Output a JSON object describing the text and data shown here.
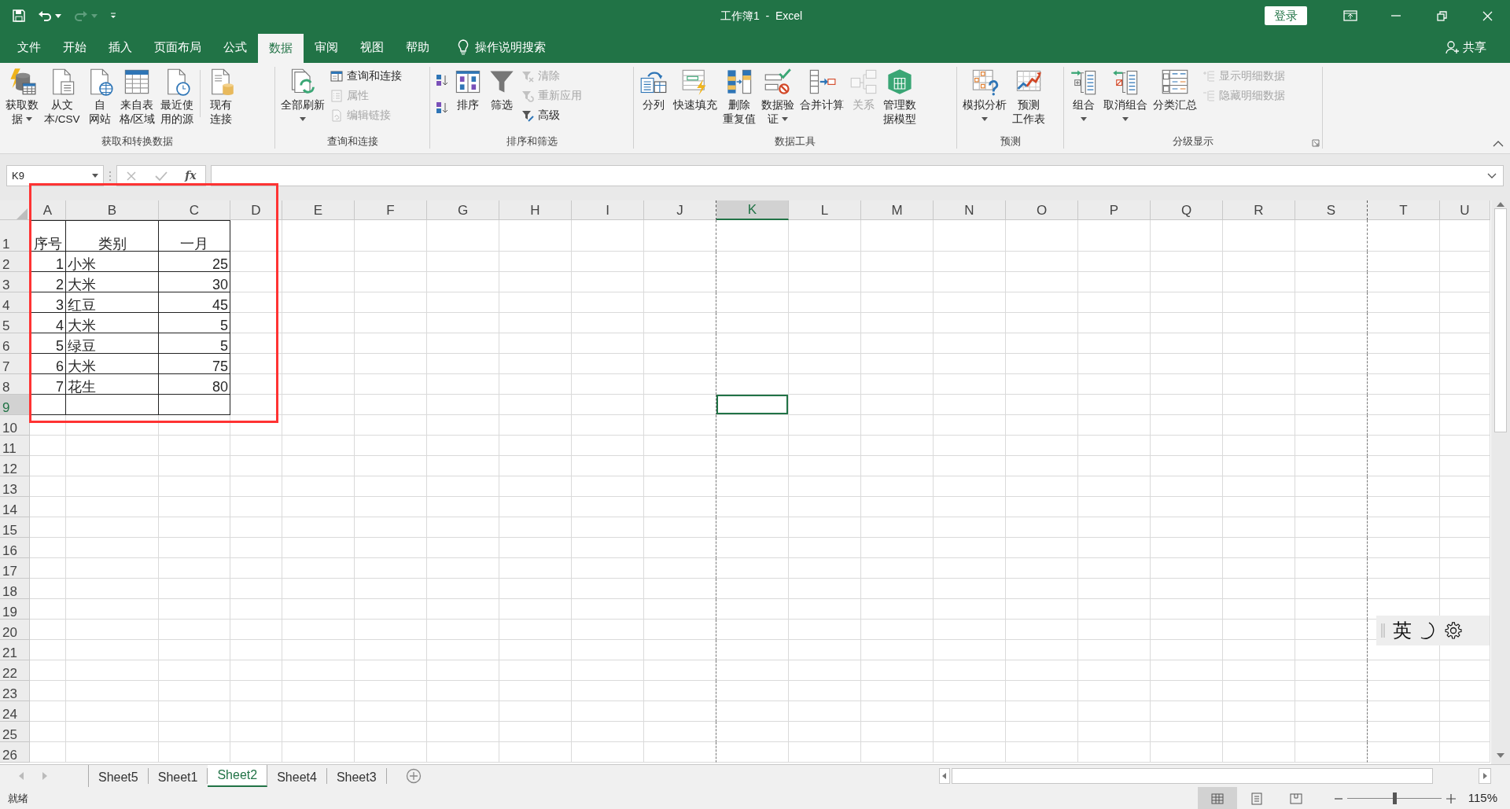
{
  "title_bar": {
    "title": "工作簿1  -  Excel",
    "sign_in": "登录",
    "redo": {
      "disabled": true
    }
  },
  "menu_tabs": [
    {
      "label": "文件",
      "selected": false
    },
    {
      "label": "开始",
      "selected": false
    },
    {
      "label": "插入",
      "selected": false
    },
    {
      "label": "页面布局",
      "selected": false
    },
    {
      "label": "公式",
      "selected": false
    },
    {
      "label": "数据",
      "selected": true
    },
    {
      "label": "审阅",
      "selected": false
    },
    {
      "label": "视图",
      "selected": false
    },
    {
      "label": "帮助",
      "selected": false
    }
  ],
  "tell_me": "操作说明搜索",
  "share": "共享",
  "ribbon": {
    "groups": [
      {
        "title": "获取和转换数据",
        "launcher": false,
        "items": [
          {
            "kind": "large",
            "lines": [
              "获取数",
              "据"
            ],
            "dropdown": true,
            "disabled": false
          },
          {
            "kind": "large",
            "lines": [
              "从文",
              "本/CSV"
            ],
            "dropdown": false,
            "disabled": false
          },
          {
            "kind": "large",
            "lines": [
              "自",
              "网站"
            ],
            "dropdown": false,
            "disabled": false
          },
          {
            "kind": "large",
            "lines": [
              "来自表",
              "格/区域"
            ],
            "dropdown": false,
            "disabled": false
          },
          {
            "kind": "large",
            "lines": [
              "最近使",
              "用的源"
            ],
            "dropdown": false,
            "disabled": false
          },
          {
            "kind": "separator"
          },
          {
            "kind": "large",
            "lines": [
              "现有",
              "连接"
            ],
            "dropdown": false,
            "disabled": false
          }
        ]
      },
      {
        "title": "查询和连接",
        "launcher": false,
        "items": [
          {
            "kind": "large",
            "lines": [
              "全部刷新"
            ],
            "dropdown": true,
            "disabled": false
          },
          {
            "kind": "stack",
            "items": [
              {
                "label": "查询和连接",
                "disabled": false
              },
              {
                "label": "属性",
                "disabled": true
              },
              {
                "label": "编辑链接",
                "disabled": true
              }
            ]
          }
        ]
      },
      {
        "title": "排序和筛选",
        "launcher": false,
        "items": [
          {
            "kind": "stack",
            "items": [
              {
                "disabled": false
              },
              {
                "disabled": false
              }
            ]
          },
          {
            "kind": "large",
            "lines": [
              "排序"
            ],
            "dropdown": false,
            "disabled": false
          },
          {
            "kind": "large",
            "lines": [
              "筛选"
            ],
            "dropdown": false,
            "disabled": false
          },
          {
            "kind": "stack",
            "items": [
              {
                "label": "清除",
                "disabled": true
              },
              {
                "label": "重新应用",
                "disabled": true
              },
              {
                "label": "高级",
                "disabled": false
              }
            ]
          }
        ]
      },
      {
        "title": "数据工具",
        "launcher": false,
        "items": [
          {
            "kind": "large",
            "lines": [
              "分列"
            ],
            "dropdown": false,
            "disabled": false
          },
          {
            "kind": "large",
            "lines": [
              "快速填充"
            ],
            "dropdown": false,
            "disabled": false
          },
          {
            "kind": "large",
            "lines": [
              "删除",
              "重复值"
            ],
            "dropdown": false,
            "disabled": false
          },
          {
            "kind": "large",
            "lines": [
              "数据验",
              "证"
            ],
            "dropdown": true,
            "disabled": false
          },
          {
            "kind": "large",
            "lines": [
              "合并计算"
            ],
            "dropdown": false,
            "disabled": false
          },
          {
            "kind": "large",
            "lines": [
              "关系"
            ],
            "dropdown": false,
            "disabled": true
          },
          {
            "kind": "large",
            "lines": [
              "管理数",
              "据模型"
            ],
            "dropdown": false,
            "disabled": false
          }
        ]
      },
      {
        "title": "预测",
        "launcher": false,
        "items": [
          {
            "kind": "large",
            "lines": [
              "模拟分析"
            ],
            "dropdown": true,
            "disabled": false
          },
          {
            "kind": "large",
            "lines": [
              "预测",
              "工作表"
            ],
            "dropdown": false,
            "disabled": false
          }
        ]
      },
      {
        "title": "分级显示",
        "launcher": true,
        "items": [
          {
            "kind": "large",
            "lines": [
              "组合"
            ],
            "dropdown": true,
            "disabled": false
          },
          {
            "kind": "large",
            "lines": [
              "取消组合"
            ],
            "dropdown": true,
            "disabled": false
          },
          {
            "kind": "large",
            "lines": [
              "分类汇总"
            ],
            "dropdown": false,
            "disabled": false
          },
          {
            "kind": "stack",
            "items": [
              {
                "label": "显示明细数据",
                "disabled": true
              },
              {
                "label": "隐藏明细数据",
                "disabled": true
              }
            ]
          }
        ]
      }
    ]
  },
  "formula_bar": {
    "name_box": "K9",
    "function_label": "fx"
  },
  "grid": {
    "columns": [
      {
        "label": "A",
        "selected": false,
        "page_break": false
      },
      {
        "label": "B",
        "selected": false,
        "page_break": false
      },
      {
        "label": "C",
        "selected": false,
        "page_break": false
      },
      {
        "label": "D",
        "selected": false,
        "page_break": false
      },
      {
        "label": "E",
        "selected": false,
        "page_break": false
      },
      {
        "label": "F",
        "selected": false,
        "page_break": false
      },
      {
        "label": "G",
        "selected": false,
        "page_break": false
      },
      {
        "label": "H",
        "selected": false,
        "page_break": false
      },
      {
        "label": "I",
        "selected": false,
        "page_break": false
      },
      {
        "label": "J",
        "selected": false,
        "page_break": true
      },
      {
        "label": "K",
        "selected": true,
        "page_break": false
      },
      {
        "label": "L",
        "selected": false,
        "page_break": false
      },
      {
        "label": "M",
        "selected": false,
        "page_break": false
      },
      {
        "label": "N",
        "selected": false,
        "page_break": false
      },
      {
        "label": "O",
        "selected": false,
        "page_break": false
      },
      {
        "label": "P",
        "selected": false,
        "page_break": false
      },
      {
        "label": "Q",
        "selected": false,
        "page_break": false
      },
      {
        "label": "R",
        "selected": false,
        "page_break": false
      },
      {
        "label": "S",
        "selected": false,
        "page_break": true
      },
      {
        "label": "T",
        "selected": false,
        "page_break": false
      },
      {
        "label": "U",
        "selected": false,
        "page_break": false
      }
    ],
    "rows": [
      {
        "label": "1",
        "selected": false,
        "tall": true,
        "cells": [
          {
            "text": "序号",
            "kind": "header",
            "bordered": true
          },
          {
            "text": "类别",
            "kind": "header",
            "bordered": true
          },
          {
            "text": "一月",
            "kind": "header",
            "bordered": true
          }
        ]
      },
      {
        "label": "2",
        "selected": false,
        "tall": false,
        "cells": [
          {
            "text": "1",
            "kind": "number",
            "bordered": true
          },
          {
            "text": "小米",
            "kind": "text",
            "bordered": true
          },
          {
            "text": "25",
            "kind": "number",
            "bordered": true
          }
        ]
      },
      {
        "label": "3",
        "selected": false,
        "tall": false,
        "cells": [
          {
            "text": "2",
            "kind": "number",
            "bordered": true
          },
          {
            "text": "大米",
            "kind": "text",
            "bordered": true
          },
          {
            "text": "30",
            "kind": "number",
            "bordered": true
          }
        ]
      },
      {
        "label": "4",
        "selected": false,
        "tall": false,
        "cells": [
          {
            "text": "3",
            "kind": "number",
            "bordered": true
          },
          {
            "text": "红豆",
            "kind": "text",
            "bordered": true
          },
          {
            "text": "45",
            "kind": "number",
            "bordered": true
          }
        ]
      },
      {
        "label": "5",
        "selected": false,
        "tall": false,
        "cells": [
          {
            "text": "4",
            "kind": "number",
            "bordered": true
          },
          {
            "text": "大米",
            "kind": "text",
            "bordered": true
          },
          {
            "text": "5",
            "kind": "number",
            "bordered": true
          }
        ]
      },
      {
        "label": "6",
        "selected": false,
        "tall": false,
        "cells": [
          {
            "text": "5",
            "kind": "number",
            "bordered": true
          },
          {
            "text": "绿豆",
            "kind": "text",
            "bordered": true
          },
          {
            "text": "5",
            "kind": "number",
            "bordered": true
          }
        ]
      },
      {
        "label": "7",
        "selected": false,
        "tall": false,
        "cells": [
          {
            "text": "6",
            "kind": "number",
            "bordered": true
          },
          {
            "text": "大米",
            "kind": "text",
            "bordered": true
          },
          {
            "text": "75",
            "kind": "number",
            "bordered": true
          }
        ]
      },
      {
        "label": "8",
        "selected": false,
        "tall": false,
        "cells": [
          {
            "text": "7",
            "kind": "number",
            "bordered": true
          },
          {
            "text": "花生",
            "kind": "text",
            "bordered": true
          },
          {
            "text": "80",
            "kind": "number",
            "bordered": true
          }
        ]
      },
      {
        "label": "9",
        "selected": true,
        "tall": false,
        "cells": [
          {
            "bordered": true
          },
          {
            "bordered": true
          },
          {
            "bordered": true
          }
        ]
      },
      {
        "label": "10",
        "selected": false,
        "tall": false
      },
      {
        "label": "11",
        "selected": false,
        "tall": false
      },
      {
        "label": "12",
        "selected": false,
        "tall": false
      },
      {
        "label": "13",
        "selected": false,
        "tall": false
      },
      {
        "label": "14",
        "selected": false,
        "tall": false
      },
      {
        "label": "15",
        "selected": false,
        "tall": false
      },
      {
        "label": "16",
        "selected": false,
        "tall": false
      },
      {
        "label": "17",
        "selected": false,
        "tall": false
      },
      {
        "label": "18",
        "selected": false,
        "tall": false
      },
      {
        "label": "19",
        "selected": false,
        "tall": false
      },
      {
        "label": "20",
        "selected": false,
        "tall": false
      },
      {
        "label": "21",
        "selected": false,
        "tall": false
      },
      {
        "label": "22",
        "selected": false,
        "tall": false
      },
      {
        "label": "23",
        "selected": false,
        "tall": false
      },
      {
        "label": "24",
        "selected": false,
        "tall": false
      },
      {
        "label": "25",
        "selected": false,
        "tall": false
      },
      {
        "label": "26",
        "selected": false,
        "tall": false
      }
    ]
  },
  "sheet_tabs": [
    {
      "label": "Sheet5",
      "selected": false
    },
    {
      "label": "Sheet1",
      "selected": false
    },
    {
      "label": "Sheet2",
      "selected": true
    },
    {
      "label": "Sheet4",
      "selected": false
    },
    {
      "label": "Sheet3",
      "selected": false
    }
  ],
  "ime_toolbar": {
    "mode": "英"
  },
  "status_bar": {
    "status": "就绪",
    "views": [
      {
        "selected": true
      },
      {
        "selected": false
      },
      {
        "selected": false
      }
    ],
    "zoom": {
      "level": 0.5,
      "reading": "115%"
    }
  }
}
